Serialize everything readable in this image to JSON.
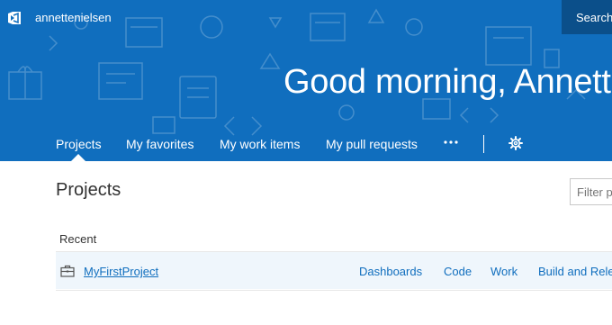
{
  "header": {
    "org_name": "annettenielsen",
    "search_label": "Search",
    "greeting": "Good morning, Annette"
  },
  "nav": {
    "tabs": [
      {
        "label": "Projects",
        "active": true
      },
      {
        "label": "My favorites"
      },
      {
        "label": "My work items"
      },
      {
        "label": "My pull requests"
      }
    ],
    "more_icon": "ellipsis-icon",
    "settings_icon": "gear-icon"
  },
  "main": {
    "title": "Projects",
    "filter_placeholder": "Filter projects",
    "recent_label": "Recent",
    "projects": [
      {
        "name": "MyFirstProject",
        "icon": "project-briefcase-icon",
        "links": [
          "Dashboards",
          "Code",
          "Work",
          "Build and Release"
        ]
      }
    ]
  },
  "colors": {
    "header_bg": "#106ebe",
    "search_bg": "#0b4f8a",
    "link": "#106ebe",
    "row_highlight": "#eff6fc"
  }
}
